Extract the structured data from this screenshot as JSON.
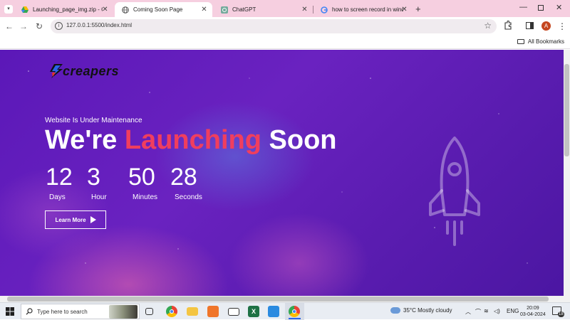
{
  "tabs": [
    {
      "title": "Launching_page_img.zip - Goo",
      "icon": "google-drive-icon"
    },
    {
      "title": "Coming Soon Page",
      "icon": "globe-icon",
      "active": true
    },
    {
      "title": "ChatGPT",
      "icon": "chatgpt-icon"
    },
    {
      "title": "how to screen record in windo",
      "icon": "google-icon"
    }
  ],
  "address": {
    "url": "127.0.0.1:5500/index.html"
  },
  "bookmarks": {
    "all_label": "All Bookmarks"
  },
  "profile": {
    "initial": "A"
  },
  "page": {
    "brand": "creapers",
    "subtitle": "Website Is Under Maintenance",
    "headline_pre": "We're ",
    "headline_accent": "Launching",
    "headline_post": " Soon",
    "countdown": [
      {
        "value": "12",
        "label": "Days"
      },
      {
        "value": "3",
        "label": "Hour"
      },
      {
        "value": "50",
        "label": "Minutes"
      },
      {
        "value": "28",
        "label": "Seconds"
      }
    ],
    "cta": "Learn More",
    "accent_color": "#f03e5e"
  },
  "taskbar": {
    "search_placeholder": "Type here to search",
    "weather": "35°C  Mostly cloudy",
    "language": "ENG",
    "time": "20:09",
    "date": "03-04-2024",
    "notifications": "18"
  }
}
